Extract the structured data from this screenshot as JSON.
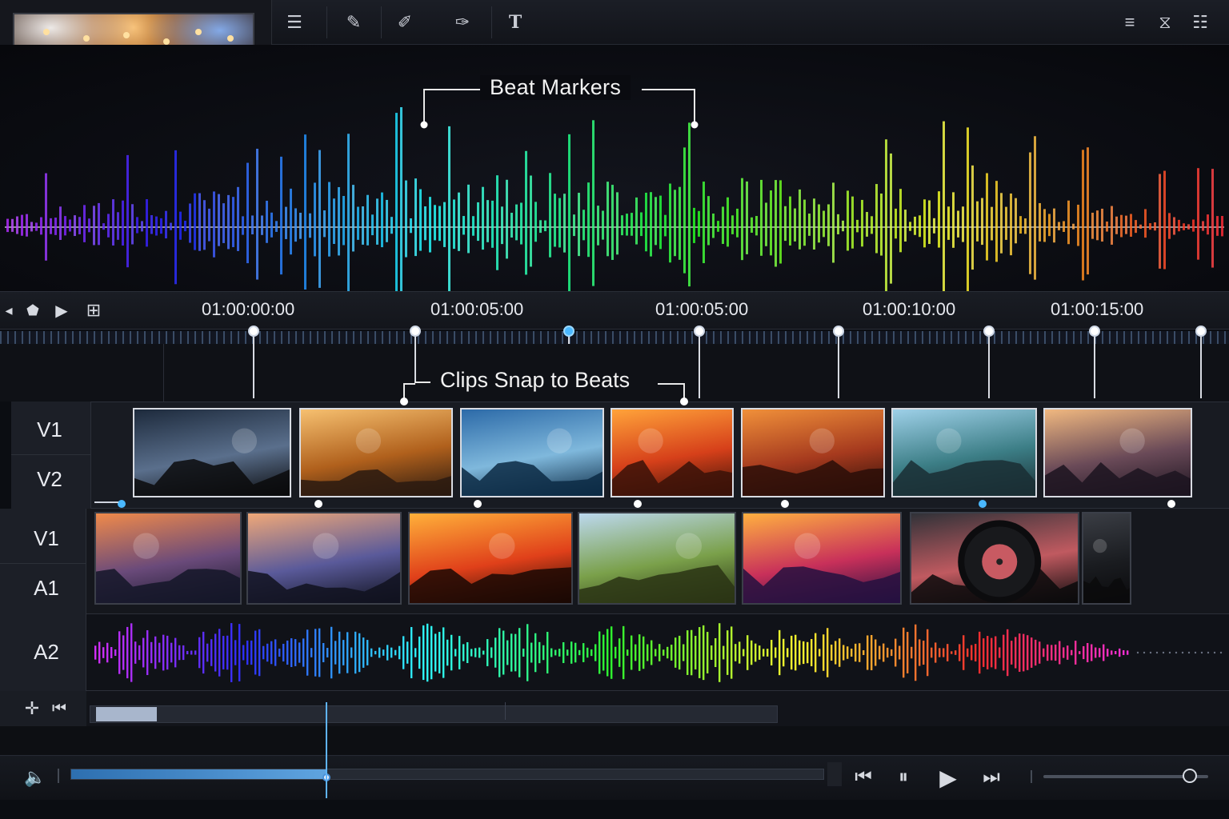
{
  "toolbar": {
    "tools": [
      {
        "name": "layers-icon",
        "glyph": "☰"
      },
      {
        "name": "magic-add-icon",
        "glyph": "✎"
      },
      {
        "name": "brush-icon",
        "glyph": "✐"
      },
      {
        "name": "eyedropper-icon",
        "glyph": "✑"
      },
      {
        "name": "text-tool-icon",
        "glyph": "T"
      }
    ],
    "right": [
      {
        "name": "menu-icon",
        "glyph": "≡"
      },
      {
        "name": "transition-icon",
        "glyph": "⧖"
      },
      {
        "name": "panel-icon",
        "glyph": "☷"
      }
    ]
  },
  "labels": {
    "beat_markers": "Beat Markers",
    "clips_snap": "Clips Snap to Beats"
  },
  "ruler": {
    "timecodes": [
      "01:00:00:00",
      "01:00:05:00",
      "01:00:05:00",
      "01:00:10:00",
      "01:00:15:00"
    ]
  },
  "transport_left": [
    {
      "name": "back-icon",
      "glyph": "◂"
    },
    {
      "name": "marker-icon",
      "glyph": "⬟"
    },
    {
      "name": "play-small-icon",
      "glyph": "▶"
    },
    {
      "name": "add-marker-icon",
      "glyph": "⊞"
    }
  ],
  "tracks": {
    "v1_top": "V1",
    "v2": "V2",
    "v1_bottom": "V1",
    "a1": "A1",
    "a2": "A2"
  },
  "clips_row1": [
    {
      "name": "dj-turntable-clip",
      "c1": "#1d2a3c",
      "c2": "#5a6f8c",
      "c3": "#0a0a0c"
    },
    {
      "name": "car-sunset-clip",
      "c1": "#f6c070",
      "c2": "#b0601c",
      "c3": "#2a1a10"
    },
    {
      "name": "surfer-wave-clip",
      "c1": "#2c6aa8",
      "c2": "#7fb8dc",
      "c3": "#0c2a44"
    },
    {
      "name": "backpack-lights-clip",
      "c1": "#ffa33a",
      "c2": "#d6401a",
      "c3": "#3a1208"
    },
    {
      "name": "woman-party-clip",
      "c1": "#f0903a",
      "c2": "#a63a1e",
      "c3": "#2a0e08"
    },
    {
      "name": "wave-jump-clip",
      "c1": "#9ed0e8",
      "c2": "#3c7e86",
      "c3": "#1a2e34"
    },
    {
      "name": "cliff-jump-clip",
      "c1": "#f0b880",
      "c2": "#6a4a58",
      "c3": "#1c1420"
    }
  ],
  "clips_row2": [
    {
      "name": "city-skyline-clip",
      "c1": "#f08a4a",
      "c2": "#6a4a7a",
      "c3": "#141628"
    },
    {
      "name": "palm-city-clip",
      "c1": "#f0a878",
      "c2": "#5a5a9a",
      "c3": "#10121e"
    },
    {
      "name": "beach-sunset-clip",
      "c1": "#ffb03a",
      "c2": "#e0401a",
      "c3": "#1a0804"
    },
    {
      "name": "cyclist-field-clip",
      "c1": "#bcd8ee",
      "c2": "#7aa04a",
      "c3": "#2a3414"
    },
    {
      "name": "cyclist-sunset-clip",
      "c1": "#ffb040",
      "c2": "#c8305a",
      "c3": "#241040"
    },
    {
      "name": "vinyl-record-clip",
      "c1": "#303238",
      "c2": "#c05a60",
      "c3": "#0a0a0c"
    },
    {
      "name": "dark-clip",
      "c1": "#3a3d44",
      "c2": "#1a1c20",
      "c3": "#0a0a0c"
    }
  ],
  "nav": [
    {
      "name": "snap-icon",
      "glyph": "✛"
    },
    {
      "name": "skip-start-icon",
      "glyph": "⏮"
    }
  ],
  "playback": {
    "volume_icon": "🔈",
    "progress": 0.34,
    "buttons": [
      {
        "name": "previous-icon",
        "glyph": "⏮"
      },
      {
        "name": "pause-icon",
        "glyph": "⏸"
      },
      {
        "name": "play-icon",
        "glyph": "▶"
      },
      {
        "name": "next-icon",
        "glyph": "⏭"
      }
    ],
    "zoom_level": 0.89
  },
  "colors": {
    "accent": "#4aa8e8",
    "marker": "#ffffff"
  }
}
